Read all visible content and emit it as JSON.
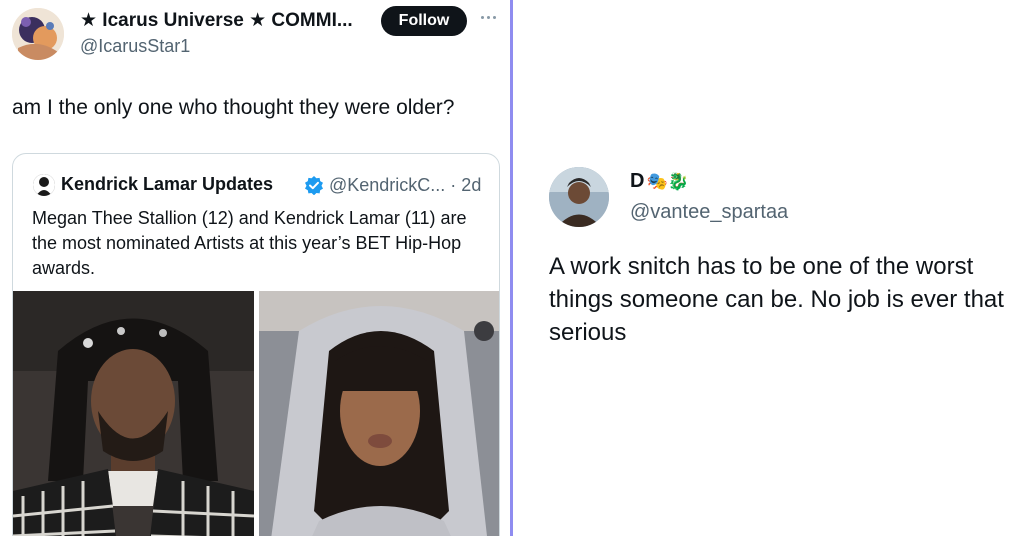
{
  "left_tweet": {
    "author_name": "★ Icarus Universe ★ COMMI...",
    "author_handle": "@IcarusStar1",
    "follow_label": "Follow",
    "text": "am I the only one who thought they were older?",
    "quote": {
      "author_name": "Kendrick Lamar Updates",
      "handle_time": "@KendrickC... · 2d",
      "text": "Megan Thee Stallion (12) and Kendrick Lamar (11) are the most nominated Artists at this year’s BET Hip-Hop awards.",
      "verified_color": "#1d9bf0"
    }
  },
  "right_tweet": {
    "author_name": "D",
    "author_emojis": "🎭🐉",
    "author_handle": "@vantee_spartaa",
    "text": "A work snitch has to be one of the worst things someone can be. No job is ever that serious"
  },
  "colors": {
    "divider": "#8f8cf0",
    "text_primary": "#0f1419",
    "text_secondary": "#536471"
  }
}
